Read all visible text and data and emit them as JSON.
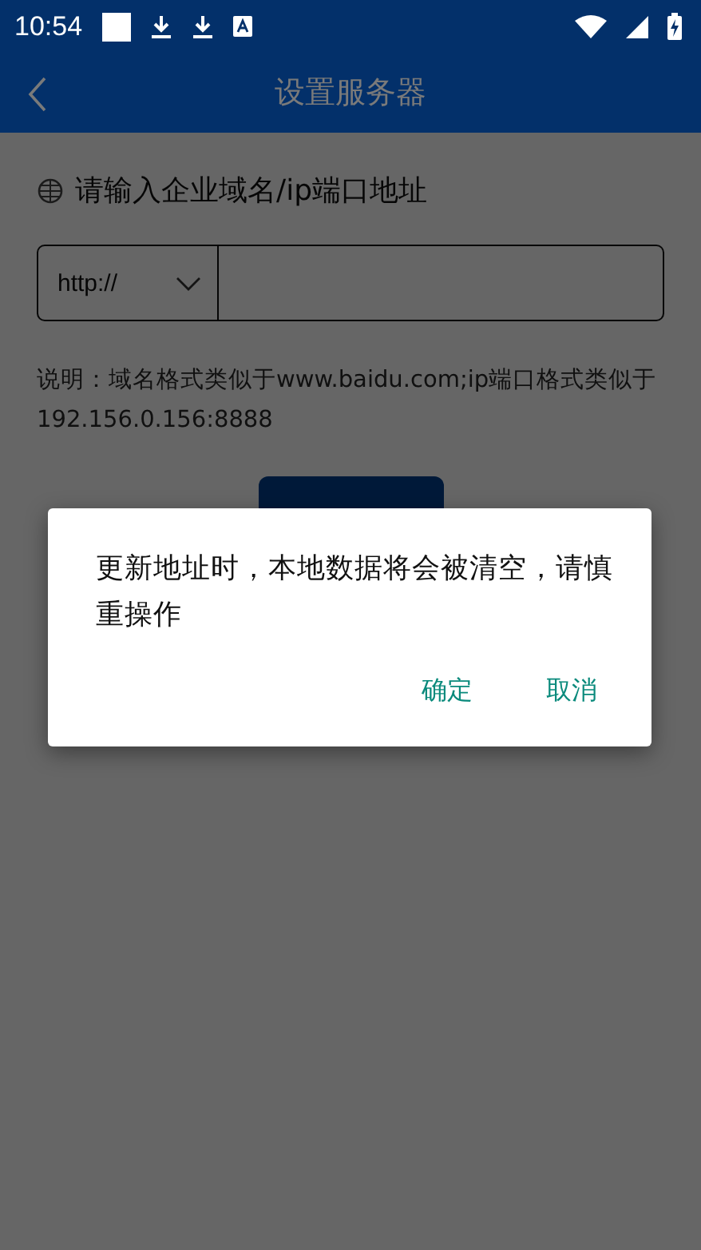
{
  "status_bar": {
    "time": "10:54"
  },
  "app_bar": {
    "title": "设置服务器"
  },
  "form": {
    "label": "请输入企业域名/ip端口地址",
    "protocol": "http://",
    "hint": "说明：域名格式类似于www.baidu.com;ip端口格式类似于192.156.0.156:8888"
  },
  "dialog": {
    "message": "更新地址时，本地数据将会被清空，请慎重操作",
    "buttons": [
      {
        "label": "确定"
      },
      {
        "label": "取消"
      }
    ]
  }
}
